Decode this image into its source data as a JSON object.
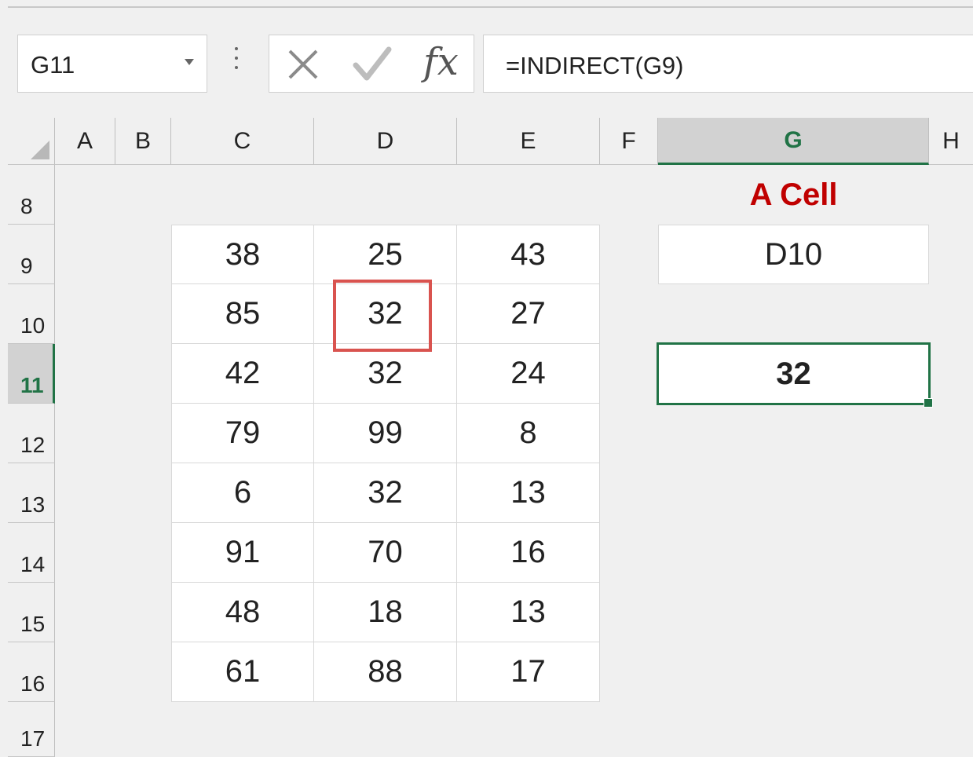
{
  "formula_bar": {
    "name_box": "G11",
    "fx_label": "fx",
    "formula": "=INDIRECT(G9)"
  },
  "sheet": {
    "columns": [
      "A",
      "B",
      "C",
      "D",
      "E",
      "F",
      "G",
      "H"
    ],
    "selected_column": "G",
    "rows": [
      "8",
      "9",
      "10",
      "11",
      "12",
      "13",
      "14",
      "15",
      "16",
      "17"
    ],
    "selected_row": "11",
    "table": [
      [
        "38",
        "25",
        "43"
      ],
      [
        "85",
        "32",
        "27"
      ],
      [
        "42",
        "32",
        "24"
      ],
      [
        "79",
        "99",
        "8"
      ],
      [
        "6",
        "32",
        "13"
      ],
      [
        "91",
        "70",
        "16"
      ],
      [
        "48",
        "18",
        "13"
      ],
      [
        "61",
        "88",
        "17"
      ]
    ],
    "highlighted_cell": "D10",
    "g8_heading": "A Cell",
    "g9_reference": "D10",
    "g11_result": "32"
  },
  "colors": {
    "accent_green": "#217346",
    "heading_red": "#c00000",
    "highlight_red": "#d9534f"
  },
  "icons": {
    "cancel": "x-icon",
    "enter": "check-icon",
    "function": "fx-icon"
  }
}
